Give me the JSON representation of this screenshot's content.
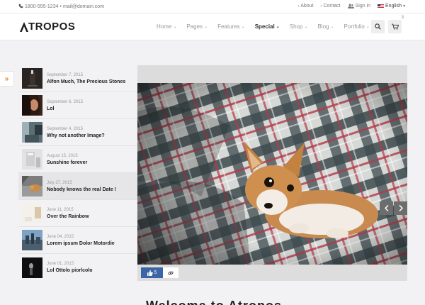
{
  "topbar": {
    "phone": "1800-555-1234",
    "separator": "•",
    "email": "mail@domain.com",
    "about": "About",
    "contact": "Contact",
    "signin": "Sign in",
    "language": "English"
  },
  "brand": {
    "name_rest": "TROPOS"
  },
  "nav": {
    "items": [
      {
        "label": "Home"
      },
      {
        "label": "Pages"
      },
      {
        "label": "Features"
      },
      {
        "label": "Special"
      },
      {
        "label": "Shop"
      },
      {
        "label": "Blog"
      },
      {
        "label": "Portfolio"
      }
    ]
  },
  "header": {
    "cart_count": "3"
  },
  "posts": [
    {
      "date": "September 7, 2015",
      "title": "Alfon Much, The Precious Stones"
    },
    {
      "date": "September 6, 2015",
      "title": "Lol"
    },
    {
      "date": "September 4, 2015",
      "title": "Why not another Image?"
    },
    {
      "date": "August 15, 2015",
      "title": "Sunshine forever"
    },
    {
      "date": "July 27, 2015",
      "title": "Nobody knows the real Date !"
    },
    {
      "date": "June 11, 2015",
      "title": "Over the Rainbow"
    },
    {
      "date": "June 04, 2015",
      "title": "Lorem ipsum Dolor Motordie"
    },
    {
      "date": "June 01, 2015",
      "title": "Lol Ottolo piorlcolo"
    }
  ],
  "feature": {
    "likes": "5"
  },
  "welcome": {
    "text": "Welcome to Atropos"
  },
  "colors": {
    "accent": "#f07c1a",
    "like": "#3b65a3"
  }
}
